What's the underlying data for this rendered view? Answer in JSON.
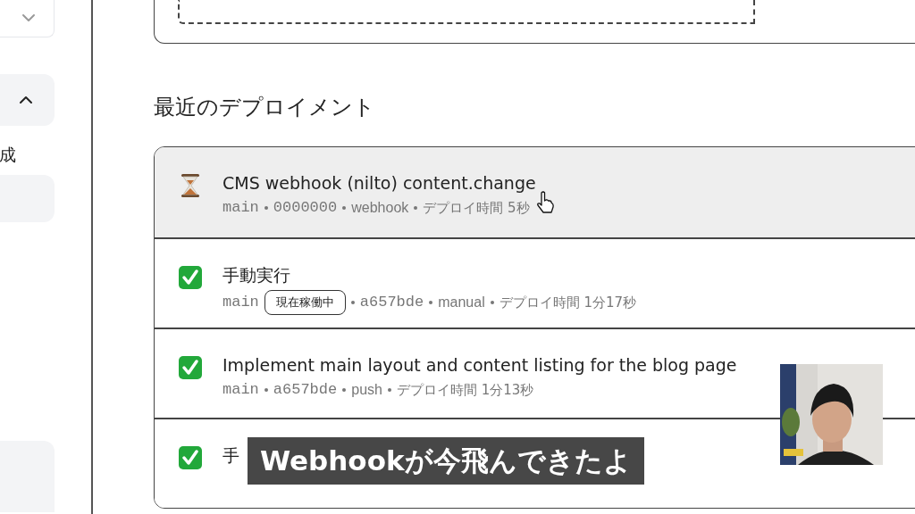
{
  "sidebar": {
    "dropdown": {
      "expanded": false
    },
    "section": {
      "expanded": true
    },
    "label": "成"
  },
  "heading": "最近のデプロイメント",
  "deployments": [
    {
      "kind": "pending",
      "highlighted": true,
      "title": "CMS webhook (nilto) content.change",
      "branch": "main",
      "commit": "0000000",
      "trigger": "webhook",
      "duration": "デプロイ時間 5秒"
    },
    {
      "kind": "success",
      "highlighted": false,
      "title": "手動実行",
      "branch": "main",
      "badge": "現在稼働中",
      "commit": "a657bde",
      "trigger": "manual",
      "duration": "デプロイ時間 1分17秒"
    },
    {
      "kind": "success",
      "highlighted": false,
      "title": "Implement main layout and content listing for the blog page",
      "branch": "main",
      "commit": "a657bde",
      "trigger": "push",
      "duration": "デプロイ時間 1分13秒"
    },
    {
      "kind": "success",
      "highlighted": false,
      "title": "手"
    }
  ],
  "subtitle": "Webhookが今飛んできたよ"
}
